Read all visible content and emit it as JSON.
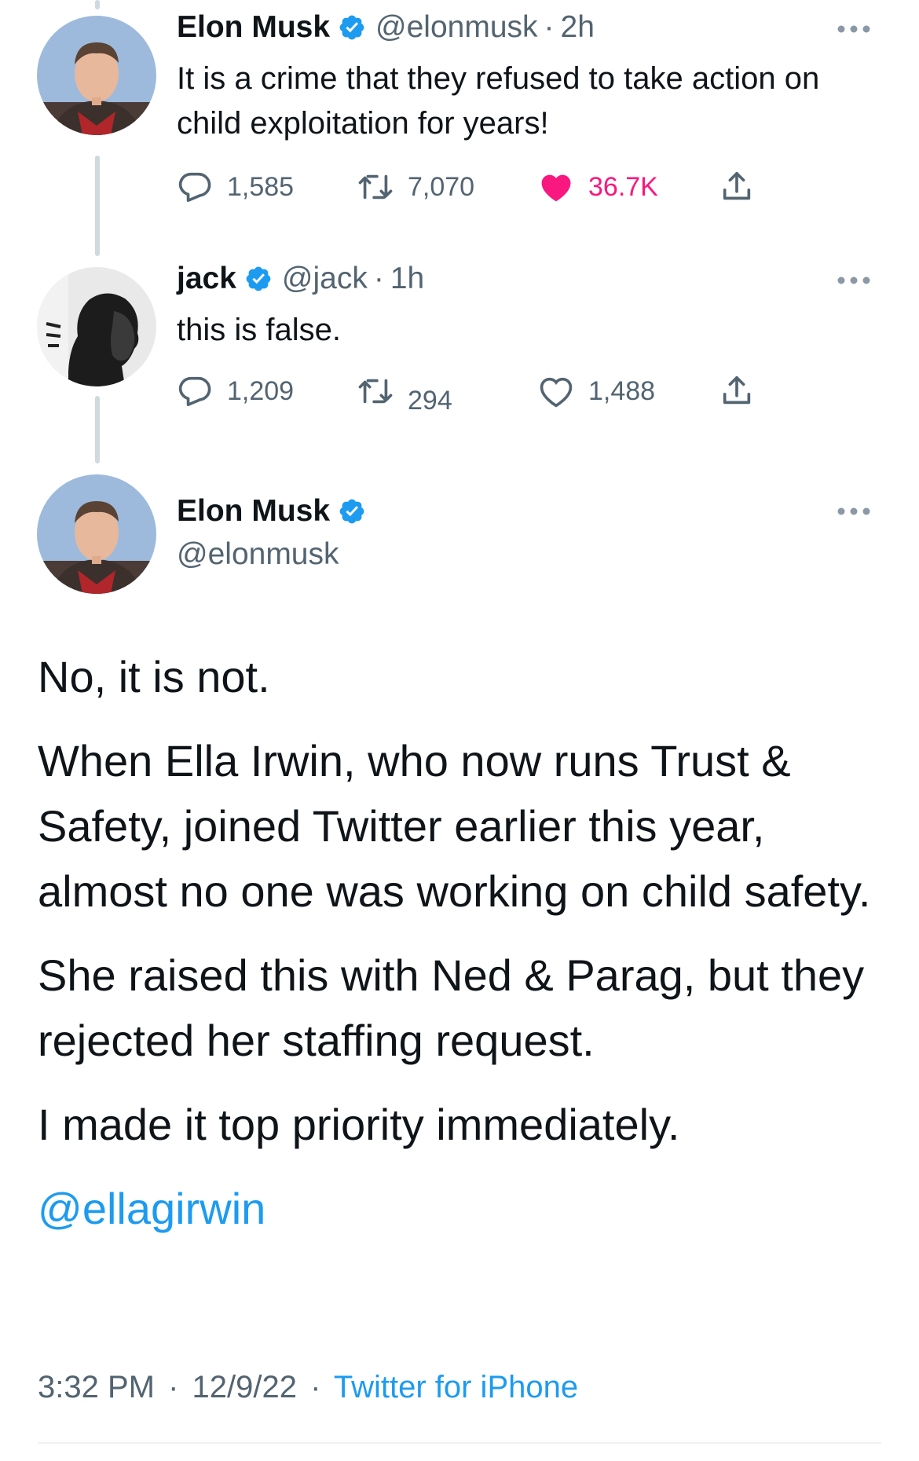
{
  "tweets": [
    {
      "name": "Elon Musk",
      "handle": "@elonmusk",
      "sep": "·",
      "time": "2h",
      "text": "It is a crime that they refused to take action on child exploitation for years!",
      "replies": "1,585",
      "retweets": "7,070",
      "likes": "36.7K",
      "liked": true
    },
    {
      "name": "jack",
      "handle": "@jack",
      "sep": "·",
      "time": "1h",
      "text": "this is false.",
      "replies": "1,209",
      "retweets": "294",
      "likes": "1,488",
      "liked": false
    }
  ],
  "main_tweet": {
    "name": "Elon Musk",
    "handle": "@elonmusk",
    "paragraphs": [
      "No, it is not.",
      "When Ella Irwin, who now runs Trust & Safety, joined Twitter earlier this year, almost no one was working on child safety.",
      "She raised this with Ned & Parag, but they rejected her staffing request.",
      "I made it top priority immediately."
    ],
    "mention": "@ellagirwin",
    "time": "3:32 PM",
    "sep": "·",
    "date": "12/9/22",
    "source": "Twitter for iPhone"
  },
  "colors": {
    "accent": "#1d9bf0",
    "like": "#f91880",
    "muted": "#536471",
    "thread_line": "#cfd9de"
  },
  "icons": [
    "verified-badge-icon",
    "more-options-icon",
    "reply-icon",
    "retweet-icon",
    "like-icon",
    "share-icon"
  ]
}
